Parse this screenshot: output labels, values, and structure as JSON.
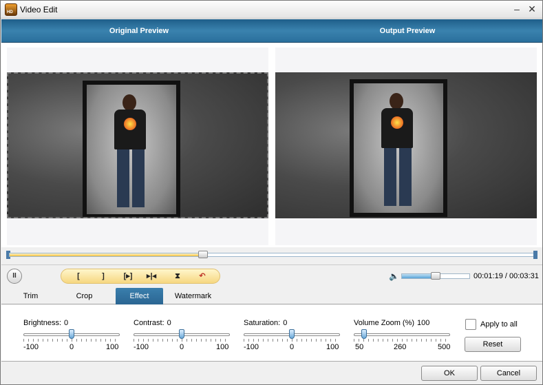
{
  "window": {
    "title": "Video Edit",
    "app_icon_text": "HD",
    "minimize_glyph": "–",
    "close_glyph": "✕"
  },
  "preview": {
    "original_label": "Original Preview",
    "output_label": "Output Preview"
  },
  "seek": {
    "progress_fraction": 0.37
  },
  "player": {
    "pause_glyph": "II",
    "tools": [
      {
        "name": "mark-in-icon",
        "glyph": "["
      },
      {
        "name": "mark-out-icon",
        "glyph": "]"
      },
      {
        "name": "split-play-icon",
        "glyph": "[▸]"
      },
      {
        "name": "prev-frame-icon",
        "glyph": "▸|◂"
      },
      {
        "name": "merge-icon",
        "glyph": "⧗"
      },
      {
        "name": "undo-icon",
        "glyph": "↶"
      }
    ],
    "volume_fraction": 0.5,
    "current_time": "00:01:19",
    "total_time": "00:03:31"
  },
  "tabs": [
    {
      "label": "Trim",
      "active": false
    },
    {
      "label": "Crop",
      "active": false
    },
    {
      "label": "Effect",
      "active": true
    },
    {
      "label": "Watermark",
      "active": false
    }
  ],
  "effect": {
    "brightness": {
      "label": "Brightness:",
      "value": "0",
      "min": "-100",
      "mid": "0",
      "max": "100",
      "fraction": 0.5
    },
    "contrast": {
      "label": "Contrast:",
      "value": "0",
      "min": "-100",
      "mid": "0",
      "max": "100",
      "fraction": 0.5
    },
    "saturation": {
      "label": "Saturation:",
      "value": "0",
      "min": "-100",
      "mid": "0",
      "max": "100",
      "fraction": 0.5
    },
    "volume_zoom": {
      "label": "Volume Zoom (%)",
      "value": "100",
      "min": "50",
      "mid": "260",
      "max": "500",
      "fraction": 0.11
    },
    "apply_all_label": "Apply to all",
    "apply_all_checked": false,
    "reset_label": "Reset"
  },
  "footer": {
    "ok_label": "OK",
    "cancel_label": "Cancel"
  },
  "colors": {
    "band": "#2a6f9c",
    "active_tab": "#2a6592",
    "seek_fill": "#f0c040"
  }
}
